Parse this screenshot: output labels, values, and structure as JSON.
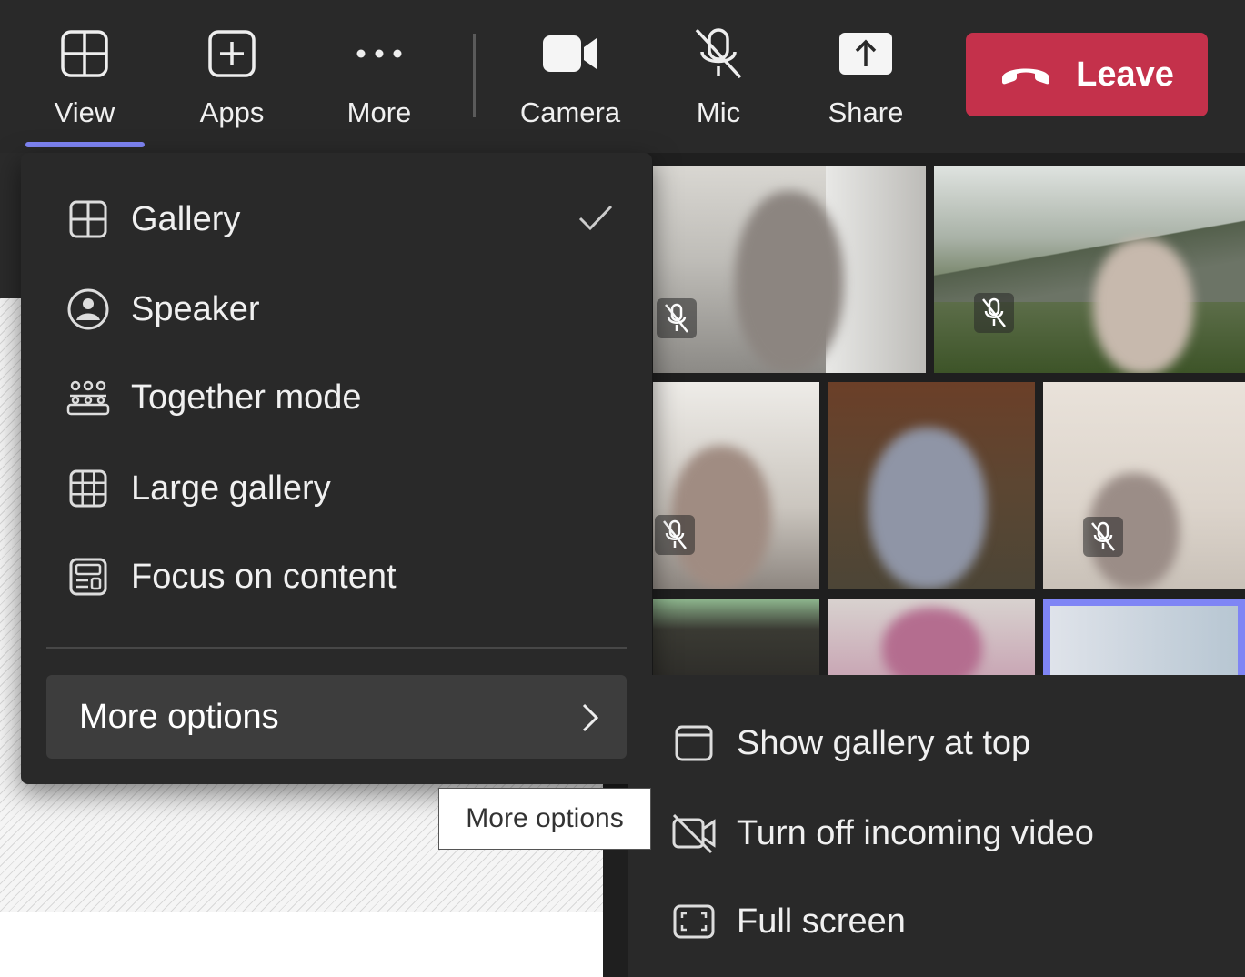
{
  "toolbar": {
    "view": "View",
    "apps": "Apps",
    "more": "More",
    "camera": "Camera",
    "mic": "Mic",
    "share": "Share",
    "leave": "Leave"
  },
  "view_menu": {
    "items": [
      {
        "label": "Gallery",
        "icon": "gallery-icon",
        "checked": true
      },
      {
        "label": "Speaker",
        "icon": "speaker-icon",
        "checked": false
      },
      {
        "label": "Together mode",
        "icon": "together-mode-icon",
        "checked": false
      },
      {
        "label": "Large gallery",
        "icon": "large-gallery-icon",
        "checked": false
      },
      {
        "label": "Focus on content",
        "icon": "focus-content-icon",
        "checked": false
      }
    ],
    "more_options": "More options"
  },
  "sub_menu": {
    "items": [
      {
        "label": "Show gallery at top",
        "icon": "window-icon"
      },
      {
        "label": "Turn off incoming video",
        "icon": "video-off-icon"
      },
      {
        "label": "Full screen",
        "icon": "fullscreen-icon"
      }
    ]
  },
  "tooltip": "More options",
  "colors": {
    "accent": "#7f85f5",
    "leave": "#c4314b",
    "menu_bg": "#292929"
  }
}
